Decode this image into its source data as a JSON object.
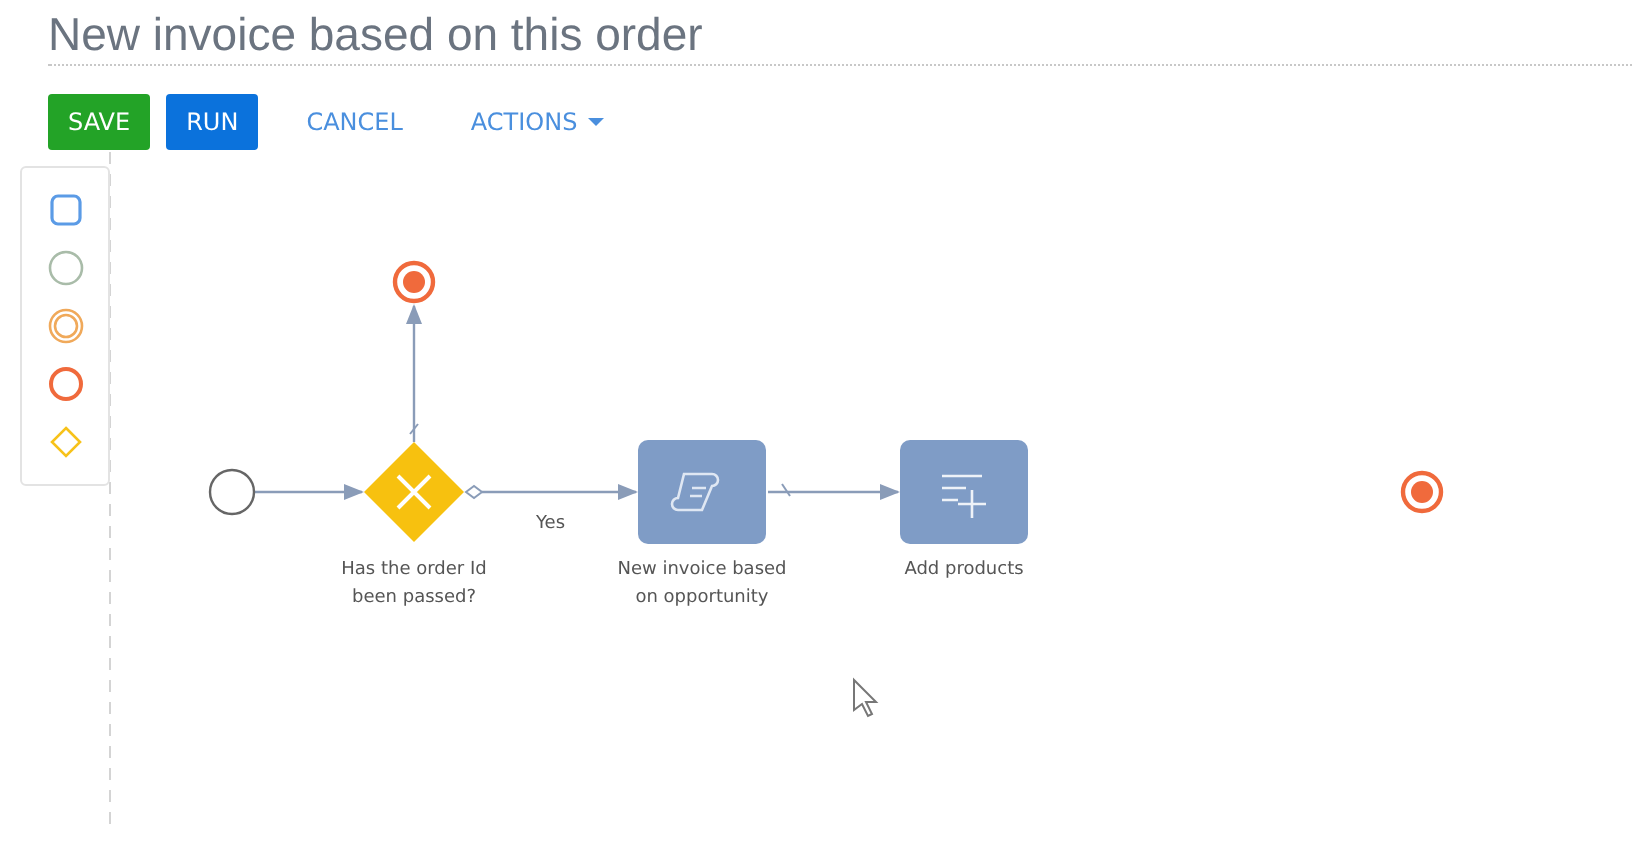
{
  "title": "New invoice based on this order",
  "toolbar": [
    {
      "kind": "save",
      "label": "SAVE"
    },
    {
      "kind": "run",
      "label": "RUN"
    },
    {
      "kind": "link",
      "label": "CANCEL"
    },
    {
      "kind": "dropdown",
      "label": "ACTIONS"
    }
  ],
  "palette": [
    {
      "kind": "task"
    },
    {
      "kind": "start"
    },
    {
      "kind": "intermediate"
    },
    {
      "kind": "end"
    },
    {
      "kind": "gateway"
    }
  ],
  "diagram": {
    "nodes": [
      {
        "kind": "start"
      },
      {
        "kind": "gateway",
        "label": [
          "Has the order Id",
          "been passed?"
        ]
      },
      {
        "kind": "end"
      },
      {
        "kind": "task",
        "label": [
          "New invoice based",
          "on opportunity"
        ]
      },
      {
        "kind": "task",
        "label": [
          "Add products"
        ]
      },
      {
        "kind": "end"
      }
    ],
    "flow_label": "Yes"
  }
}
